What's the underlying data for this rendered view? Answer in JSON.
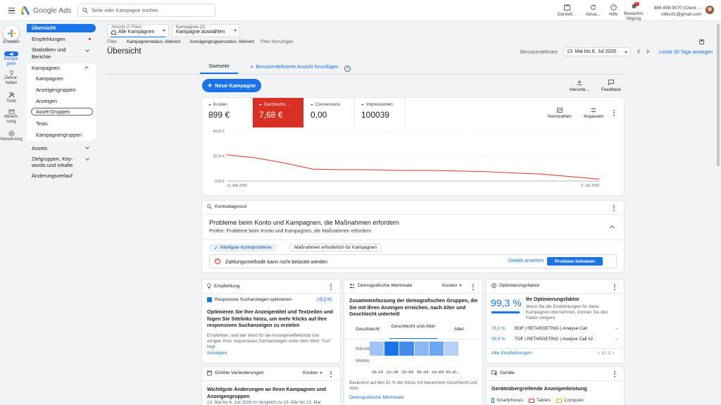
{
  "header": {
    "search_placeholder": "Seite oder Kampagne suchen",
    "logo_text": "Google Ads",
    "icons": [
      {
        "label": "Darstell..."
      },
      {
        "label": "Aktua..."
      },
      {
        "label": "Hilfe"
      },
      {
        "label": "Benachrichtigung",
        "badge": "1"
      }
    ],
    "account_id": "886-958-9070 (Client ...",
    "account_email": "rdtko31@gmail.com"
  },
  "rail": {
    "create_label": "Erstellen",
    "items": [
      {
        "label": "Kampa-gnen",
        "icon": "campaigns-icon"
      },
      {
        "label": "Zielvor-haben",
        "icon": "trophy-icon"
      },
      {
        "label": "Tools",
        "icon": "tools-icon"
      },
      {
        "label": "Abrech-nung",
        "icon": "billing-icon"
      },
      {
        "label": "Verwal-tung",
        "icon": "admin-gear-icon"
      }
    ]
  },
  "nav": {
    "overview": "Übersicht",
    "recommendations": "Empfehlungen",
    "stats": "Statistiken und Berichte",
    "campaigns_group": "Kampagnen",
    "sub": [
      "Kampagnen",
      "Anzeigengruppen",
      "Anzeigen",
      "Asset-Gruppen",
      "Tests",
      "Kampagnengruppen"
    ],
    "assets": "Assets",
    "audiences": "Zielgruppen, Key-words und Inhalte",
    "history": "Änderungsverlauf"
  },
  "filters": {
    "view_label": "Ansicht (2 Filter)",
    "view_value": "Alle Kampagnen",
    "camp_label": "Kampagnen (2)",
    "camp_value": "Kampagne auswählen",
    "filter_label": "Filter",
    "chip1": "Kampagnenstatus: Aktiviert",
    "chip2": "Anzeigengruppenstatus: Aktiviert",
    "add": "Filter hinzufügen"
  },
  "page": {
    "title": "Übersicht",
    "date_mode": "Benutzerdefiniert",
    "date_range": "13. Mai bis 6. Jul 2026",
    "last30": "Letzte 30 Tage anzeigen",
    "tab_home": "Startseite",
    "tab_add": "Benutzerdefinierte Ansicht hinzufügen",
    "new_campaign": "Neue Kampagne",
    "download": "Herunte...",
    "feedback": "Feedback"
  },
  "metrics": [
    {
      "label": "Kosten",
      "value": "899 €"
    },
    {
      "label": "Durchschn. ...",
      "value": "7,68 €"
    },
    {
      "label": "Conversions",
      "value": "0,00"
    },
    {
      "label": "Impressionen",
      "value": "100039"
    }
  ],
  "metric_actions": {
    "chart": "Kennzahlen",
    "adjust": "Anpassen"
  },
  "chart_data": {
    "type": "line",
    "y_ticks": [
      "40,00 €",
      "20,00 €",
      "0,00 €"
    ],
    "ylim": [
      0,
      40
    ],
    "x_start": "13. Mai 2026",
    "x_end": "6. Juli 2026",
    "series": [
      {
        "color": "#d93025",
        "values": [
          21,
          18.5,
          14.5,
          9.5,
          9,
          9,
          8.5,
          8.5,
          8,
          7.5,
          6.5,
          5.5,
          3.5,
          1.5
        ]
      }
    ]
  },
  "diag": {
    "header": "Kontodiagnose",
    "title": "Probleme beim Konto und Kampagnen, die Maßnahmen erfordern",
    "subtitle": "Prüfen: Probleme beim Konto und Kampagnen, die Maßnahmen erfordern",
    "chip_active": "Häufigste Kontoprobleme",
    "chip_other": "Maßnahmen erforderlich für Kampagnen",
    "issue": "Zahlungsmethode kann nicht belastet werden",
    "details": "Details ansehen",
    "fix": "Problem beheben"
  },
  "rec": {
    "header": "Empfehlung",
    "item": "Responsive Suchanzeigen optimieren",
    "delta": "+0,2 %",
    "title": "Optimieren Sie Ihre Anzeigentitel und Textzeilen und fügen Sie Sitelinks hinzu, um mehr Klicks auf Ihre responsiven Suchanzeigen zu erzielen",
    "desc": "Empfehlen, weil der Wert für die Anzeigeneffektivität von einigen Ihrer responsiven Suchanzeigen unter dem Wert \"Gut\" liegt",
    "link": "Anzeigen"
  },
  "demo": {
    "header": "Demografische Merkmale",
    "metric": "Kosten",
    "title": "Zusammenfassung der demografischen Gruppen, die Sie mit Ihren Anzeigen erreichen, nach Alter und Geschlecht unterteilt",
    "tabs": [
      "Geschlecht",
      "Geschlecht und Alter",
      "Alter"
    ],
    "rows": [
      "Männlich",
      "Weiblich"
    ],
    "ages": [
      "18–24",
      "25–34",
      "35–44",
      "45–54",
      "55–64",
      "65 un..."
    ],
    "heat_male": [
      0.35,
      1.0,
      0.8,
      0.45,
      0.6,
      0.25
    ],
    "heat_female": [
      0,
      0,
      0,
      0,
      0,
      0
    ],
    "note": "Basierend auf den 91 % der Klicks mit bekanntem Geschlecht und Alter.",
    "link": "Demografische Merkmale"
  },
  "opt": {
    "header": "Optimierungsfaktor",
    "score": "99,3 %",
    "score_value": 0.993,
    "title": "Ihr Optimierungsfaktor",
    "desc": "Wenn Sie die Empfehlungen für diese Kampagnen übernehmen, können Sie den Faktor steigern",
    "rows": [
      {
        "pct": "76,1 %",
        "name": "BOF | RETARGETING | Analyse Call"
      },
      {
        "pct": "99,9 %",
        "name": "TOF | RETARGETING | Analyse Call #2"
      }
    ],
    "all": "Alle Empfehlungen",
    "pager": "1 / 1"
  },
  "changes": {
    "header": "Größte Veränderungen",
    "metric": "Kosten",
    "title": "Wichtigste Änderungen an Ihren Kampagnen und Anzeigengruppen",
    "sub": "13. Mai bis 6. Juli 2026 im Vergleich zu 19. Mär bis 12. Mai"
  },
  "devices": {
    "header": "Geräte",
    "title": "Geräteübergreifende Anzeigenleistung",
    "legend": [
      "Smartphones",
      "Tablets",
      "Computer"
    ]
  }
}
